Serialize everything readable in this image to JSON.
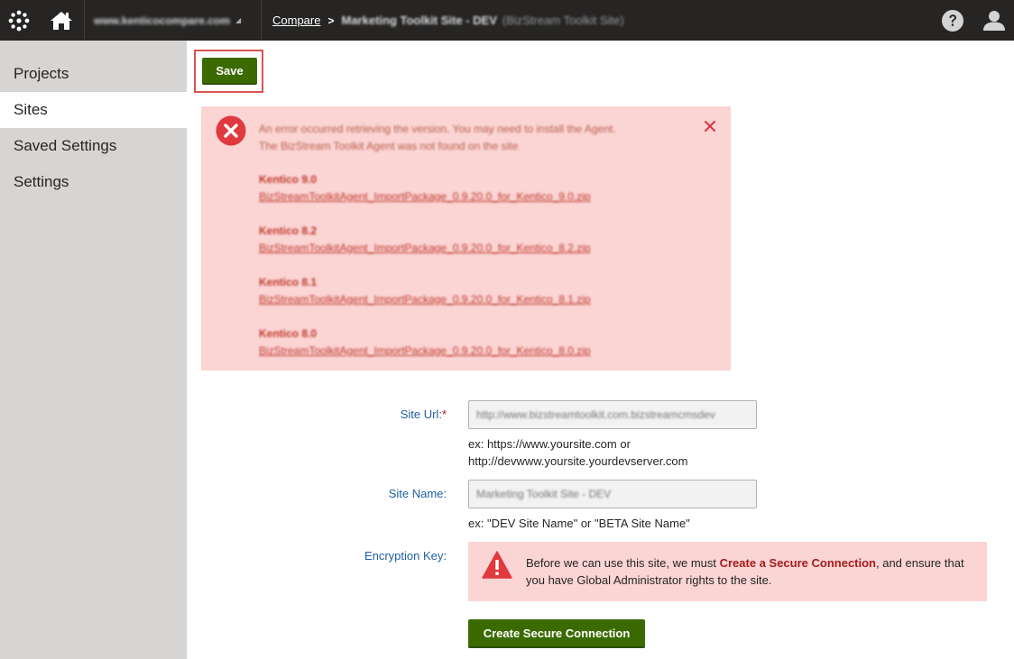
{
  "topbar": {
    "site_selector": "www.kenticocompare.com",
    "breadcrumb": {
      "link": "Compare",
      "separator": ">",
      "current": "Marketing Toolkit Site - DEV",
      "sub": "(BizStream Toolkit Site)"
    }
  },
  "sidebar": {
    "items": [
      {
        "label": "Projects"
      },
      {
        "label": "Sites"
      },
      {
        "label": "Saved Settings"
      },
      {
        "label": "Settings"
      }
    ]
  },
  "toolbar": {
    "save_label": "Save"
  },
  "error": {
    "line1": "An error occurred retrieving the version. You may need to install the Agent.",
    "line2": "The BizStream Toolkit Agent was not found on the site",
    "versions": [
      {
        "title": "Kentico 9.0",
        "link": "BizStreamToolkitAgent_ImportPackage_0.9.20.0_for_Kentico_9.0.zip"
      },
      {
        "title": "Kentico 8.2",
        "link": "BizStreamToolkitAgent_ImportPackage_0.9.20.0_for_Kentico_8.2.zip"
      },
      {
        "title": "Kentico 8.1",
        "link": "BizStreamToolkitAgent_ImportPackage_0.9.20.0_for_Kentico_8.1.zip"
      },
      {
        "title": "Kentico 8.0",
        "link": "BizStreamToolkitAgent_ImportPackage_0.9.20.0_for_Kentico_8.0.zip"
      }
    ]
  },
  "form": {
    "site_url": {
      "label": "Site Url:",
      "required_mark": "*",
      "value": "http://www.bizstreamtoolkit.com.bizstreamcmsdev",
      "hint1": "ex: https://www.yoursite.com or",
      "hint2": "http://devwww.yoursite.yourdevserver.com"
    },
    "site_name": {
      "label": "Site Name:",
      "value": "Marketing Toolkit Site - DEV",
      "hint": "ex: \"DEV Site Name\" or \"BETA Site Name\""
    },
    "encryption": {
      "label": "Encryption Key:",
      "warn_pre": "Before we can use this site, we must ",
      "warn_link": "Create a Secure Connection",
      "warn_post": ", and ensure that you have Global Administrator rights to the site.",
      "button": "Create Secure Connection"
    }
  },
  "colors": {
    "topbar": "#262524",
    "sidebar": "#d6d5d3",
    "primary_button": "#3b6b00",
    "error_bg": "#fbd4d4",
    "error_red": "#e0393e",
    "label_blue": "#1f5fa0"
  },
  "icons": {
    "logo": "kentico-logo-icon",
    "home": "home-icon",
    "help": "help-icon",
    "user": "user-icon",
    "error": "error-circle-icon",
    "close": "close-icon",
    "warning": "warning-triangle-icon"
  }
}
